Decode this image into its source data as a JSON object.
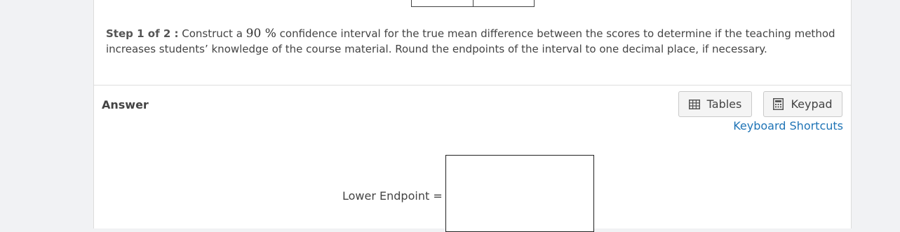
{
  "question": {
    "step_label": "Step 1 of 2 :",
    "text_before": "Construct a",
    "confidence_level": "90 %",
    "text_after": "confidence interval for the true mean difference between the scores to determine if the teaching method increases students’ knowledge of the course material. Round the endpoints of the interval to one decimal place, if necessary."
  },
  "answer": {
    "label": "Answer",
    "tables_button": "Tables",
    "keypad_button": "Keypad",
    "shortcuts_link": "Keyboard Shortcuts",
    "lower_endpoint_label": "Lower Endpoint =",
    "lower_endpoint_value": ""
  },
  "icons": {
    "tables": "table-grid-icon",
    "keypad": "calculator-icon"
  },
  "colors": {
    "link": "#1f74b6",
    "page_bg": "#f1f2f4",
    "card_bg": "#ffffff"
  }
}
